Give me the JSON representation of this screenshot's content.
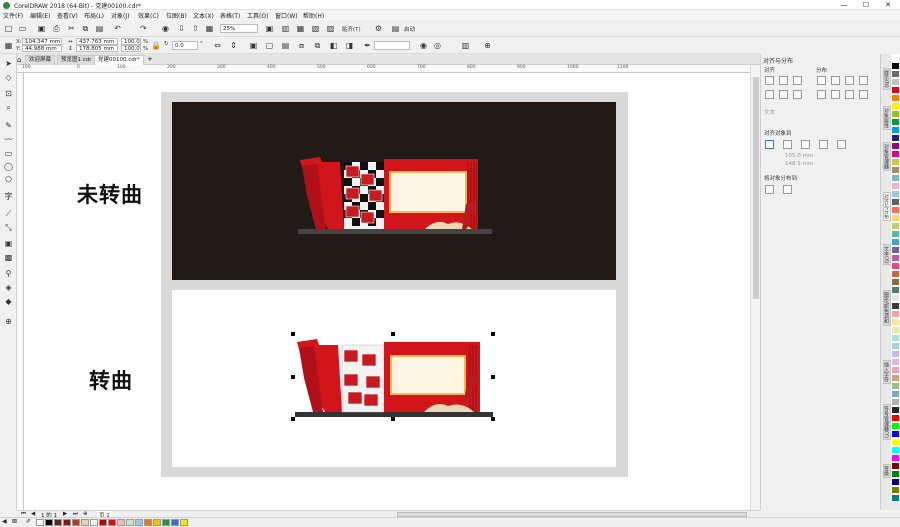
{
  "window": {
    "title": "CorelDRAW 2018 (64-Bit) - 党建00100.cdr*",
    "minimize": "—",
    "maximize": "☐",
    "close": "✕"
  },
  "menu": [
    "文件(F)",
    "编辑(E)",
    "查看(V)",
    "布局(L)",
    "对象(J)",
    "效果(C)",
    "位图(B)",
    "文本(X)",
    "表格(T)",
    "工具(O)",
    "窗口(W)",
    "帮助(H)"
  ],
  "toolbar1": {
    "zoom": "25%",
    "snap_label": "贴齐(T)",
    "launch_label": "启动"
  },
  "toolbar2": {
    "x": "104.347 mm",
    "y": "44.988 mm",
    "w": "437.763 mm",
    "h": "178.805 mm",
    "sx": "100.0",
    "sy": "100.0",
    "pct": "%",
    "angle": "0.0",
    "deg": "°"
  },
  "tabs": [
    {
      "label": "欢迎屏幕"
    },
    {
      "label": "预览图1.cdr"
    },
    {
      "label": "党建00100.cdr*"
    }
  ],
  "ruler": {
    "h": [
      "100",
      "0",
      "100",
      "200",
      "300",
      "400",
      "500",
      "600",
      "700",
      "800",
      "900",
      "1000",
      "1100"
    ],
    "v": [
      "100",
      "0",
      "-100",
      "-200",
      "-300"
    ]
  },
  "canvas": {
    "label_top": "未转曲",
    "label_bottom": "转曲"
  },
  "pagenav": {
    "counter": "1 的 1",
    "page": "页 1"
  },
  "docker": {
    "title": "对齐与分布",
    "align": "对齐",
    "distribute": "分布",
    "text": "文本",
    "align_to": "对齐对象到",
    "dist_to": "将对象分布到",
    "val1": "105.0 mm",
    "val2": "148.5 mm"
  },
  "side_tabs": [
    "提示(N)",
    "对象属性",
    "对象管理器",
    "对齐与分布",
    "文本(X)",
    "图形/颜色调和",
    "插入字符",
    "符号管理器(Y)",
    "变换"
  ],
  "palette_colors": [
    "#ffffff",
    "#000000",
    "#5a2d1a",
    "#7a1d1d",
    "#b23a2a",
    "#e8d5b0",
    "#f3f3f3",
    "#c00000",
    "#e60012",
    "#f5b7b1",
    "#c9e3c7",
    "#a0c4e8",
    "#e87a1e",
    "#f0c419",
    "#2a8f3c",
    "#3f6fb5",
    "#f7e016"
  ],
  "vpalette_colors": [
    "#ffffff",
    "#000000",
    "#6b6b6b",
    "#c0c0c0",
    "#e60012",
    "#f08300",
    "#fff100",
    "#8fc31f",
    "#009944",
    "#00a0e9",
    "#1d2088",
    "#920783",
    "#e4007f",
    "#d7c447",
    "#a58b67",
    "#7fb7be",
    "#f4b3c2",
    "#9ac9e3",
    "#5f5f5f",
    "#ff6a5a",
    "#ffd66b",
    "#b4d66b",
    "#4ec1a3",
    "#44a0d6",
    "#6d5fb1",
    "#b95b9e",
    "#e84b6f",
    "#c76a3f",
    "#8a6d3b",
    "#55796f",
    "#e7e7e7",
    "#3a3a3a",
    "#ff9e9e",
    "#ffe2a3",
    "#d8f0a5",
    "#a7e5d2",
    "#a6cff0",
    "#c5b8eb",
    "#ecb4d9",
    "#f0a3b4",
    "#d4a373",
    "#9bbf8a",
    "#7aa8c2",
    "#b0b0b0",
    "#262626",
    "#ff0000",
    "#00ff00",
    "#0000ff",
    "#ffff00",
    "#00ffff",
    "#ff00ff",
    "#800000",
    "#008000",
    "#000080",
    "#808000",
    "#008080"
  ]
}
